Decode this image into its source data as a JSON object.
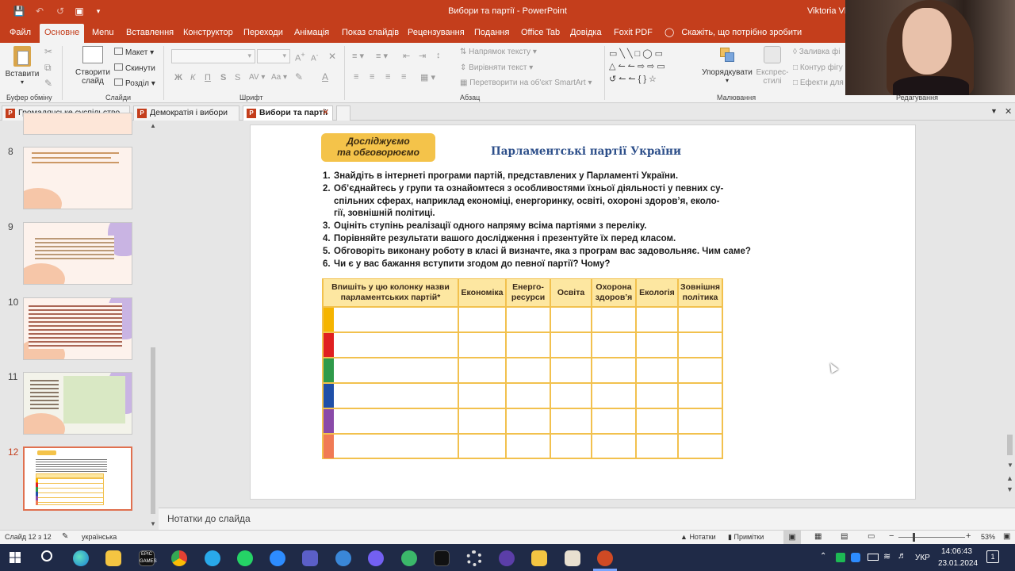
{
  "app": {
    "window_title": "Вибори та партії  -  PowerPoint",
    "user": "Viktoria Vla"
  },
  "menu": {
    "tabs": [
      "Файл",
      "Основне",
      "Menu",
      "Вставлення",
      "Конструктор",
      "Переходи",
      "Анімація",
      "Показ слайдів",
      "Рецензування",
      "Подання",
      "Office Tab",
      "Довідка",
      "Foxit PDF"
    ],
    "tell_me": "Скажіть, що потрібно зробити"
  },
  "ribbon": {
    "clipboard": {
      "paste": "Вставити",
      "group": "Буфер обміну"
    },
    "slides": {
      "new_slide_1": "Створити",
      "new_slide_2": "слайд",
      "layout": "Макет",
      "reset": "Скинути",
      "section": "Розділ",
      "group": "Слайди"
    },
    "font": {
      "bold": "Ж",
      "italic": "К",
      "underline": "П",
      "strike": "S",
      "group": "Шрифт"
    },
    "paragraph": {
      "text_direction": "Напрямок тексту",
      "align_text": "Вирівняти текст",
      "smartart": "Перетворити на об'єкт SmartArt",
      "group": "Абзац"
    },
    "drawing": {
      "arrange": "Упорядкувати",
      "quick_styles_1": "Експрес-",
      "quick_styles_2": "стилі",
      "fill": "Заливка фі",
      "outline": "Контур фігу",
      "effects": "Ефекти для",
      "group": "Малювання"
    },
    "editing": {
      "group": "Редагування"
    }
  },
  "doc_tabs": [
    {
      "label": "Громадянське суспільство",
      "active": false
    },
    {
      "label": "Демократія і вибори",
      "active": false
    },
    {
      "label": "Вибори та партії",
      "active": true
    }
  ],
  "thumbnails": [
    {
      "num": "8"
    },
    {
      "num": "9"
    },
    {
      "num": "10"
    },
    {
      "num": "11"
    },
    {
      "num": "12",
      "selected": true
    }
  ],
  "slide": {
    "badge_line1": "Досліджуємо",
    "badge_line2": "та обговорюємо",
    "title": "Парламентські партії України",
    "items": [
      {
        "n": "1.",
        "text": "Знайдіть в інтернеті програми партій, представлених у Парламенті України."
      },
      {
        "n": "2.",
        "text": "Об’єднайтесь у групи та ознайомтеся з особливостями їхньої діяльності у певних су-"
      },
      {
        "n": "",
        "text": "спільних сферах, наприклад економіці, енергоринку, освіті, охороні здоров’я, еколо-"
      },
      {
        "n": "",
        "text": "гії, зовнішній політиці."
      },
      {
        "n": "3.",
        "text": "Оцініть ступінь реалізації одного напряму всіма партіями з переліку."
      },
      {
        "n": "4.",
        "text": "Порівняйте результати вашого дослідження і презентуйте їх перед класом."
      },
      {
        "n": "5.",
        "text": "Обговоріть виконану роботу в класі й визначте, яка з програм вас задовольняє. Чим саме?"
      },
      {
        "n": "6.",
        "text": "Чи є у вас бажання вступити згодом до певної партії? Чому?"
      }
    ],
    "table_headers": [
      {
        "line1": "Впишіть у цю колонку назви",
        "line2": "парламентських партій*"
      },
      {
        "line1": "Економіка",
        "line2": ""
      },
      {
        "line1": "Енерго-",
        "line2": "ресурси"
      },
      {
        "line1": "Освіта",
        "line2": ""
      },
      {
        "line1": "Охорона",
        "line2": "здоров’я"
      },
      {
        "line1": "Екологія",
        "line2": ""
      },
      {
        "line1": "Зовнішня",
        "line2": "політика"
      }
    ],
    "row_colors": [
      "#f5b400",
      "#e02020",
      "#2f9a4a",
      "#1f4fa8",
      "#8a4aa8",
      "#f07a55"
    ]
  },
  "notes_placeholder": "Нотатки до слайда",
  "status": {
    "slide_info": "Слайд 12 з 12",
    "language": "українська",
    "notes_btn": "Нотатки",
    "comments_btn": "Примітки",
    "zoom": "53%"
  },
  "taskbar": {
    "time": "14:06:43",
    "date": "23.01.2024",
    "lang": "УКР",
    "notif_count": "1"
  }
}
